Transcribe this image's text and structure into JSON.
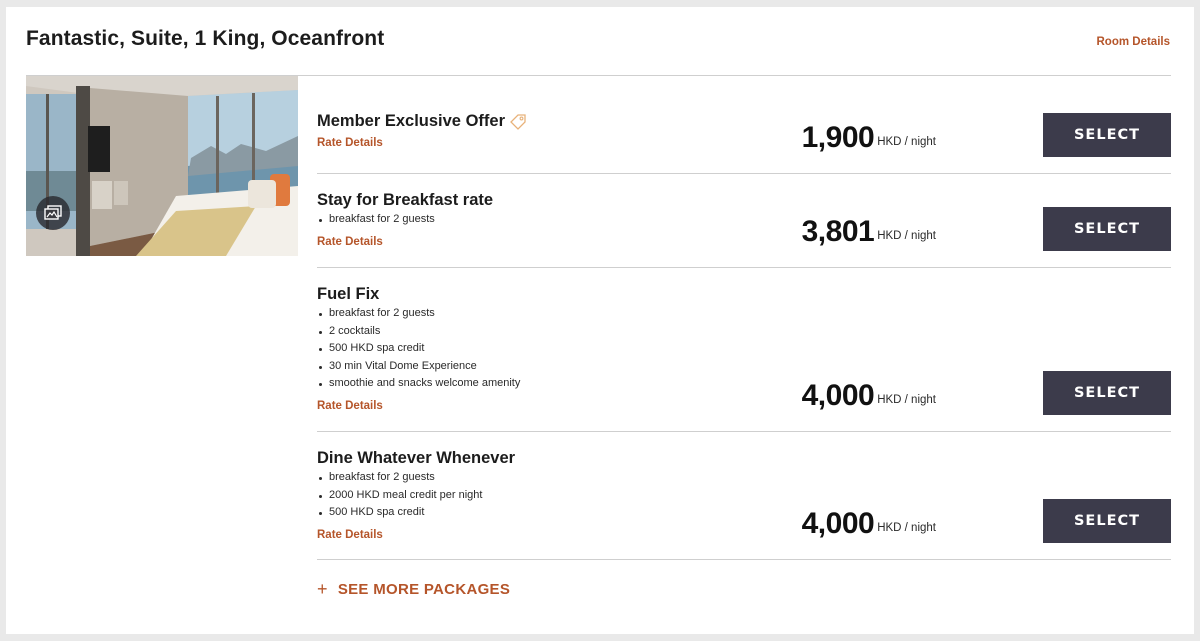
{
  "room": {
    "title": "Fantastic, Suite, 1 King, Oceanfront",
    "details_link": "Room Details",
    "photo_icon": "gallery-icon"
  },
  "rates": [
    {
      "name": "Member Exclusive Offer",
      "tag_icon": "tag-icon",
      "inclusions": [],
      "details_link": "Rate Details",
      "price": "1,900",
      "unit": "HKD / night",
      "button": "SELECT"
    },
    {
      "name": "Stay for Breakfast rate",
      "inclusions": [
        "breakfast for 2 guests"
      ],
      "details_link": "Rate Details",
      "price": "3,801",
      "unit": "HKD / night",
      "button": "SELECT"
    },
    {
      "name": "Fuel Fix",
      "inclusions": [
        "breakfast for 2 guests",
        "2 cocktails",
        "500 HKD spa credit",
        "30 min Vital Dome Experience",
        "smoothie and snacks welcome amenity"
      ],
      "details_link": "Rate Details",
      "price": "4,000",
      "unit": "HKD / night",
      "button": "SELECT"
    },
    {
      "name": "Dine Whatever Whenever",
      "inclusions": [
        "breakfast for 2 guests",
        "2000 HKD meal credit per night",
        "500 HKD spa credit"
      ],
      "details_link": "Rate Details",
      "price": "4,000",
      "unit": "HKD / night",
      "button": "SELECT"
    }
  ],
  "see_more": {
    "icon": "plus-icon",
    "label": "SEE MORE PACKAGES"
  },
  "colors": {
    "accent": "#b5552a",
    "button_bg": "#3c3b4b",
    "divider": "#cfcfcf"
  }
}
